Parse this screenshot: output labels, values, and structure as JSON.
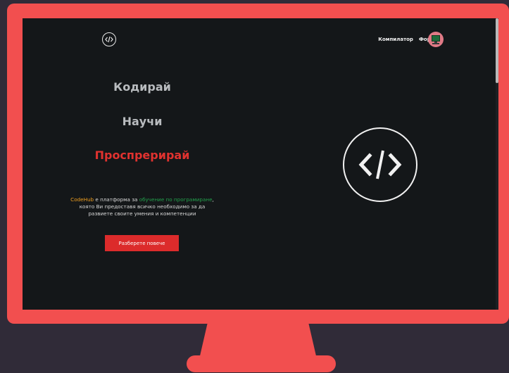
{
  "nav": {
    "logo_icon": "code-brackets-icon",
    "links": [
      {
        "label": "Компилатор"
      },
      {
        "label": "Форум"
      }
    ],
    "avatar_icon": "computer-avatar-icon"
  },
  "hero": {
    "words": [
      "Кодирай",
      "Научи",
      "Проспрерирай"
    ],
    "tagline": {
      "brand": "CodeHub",
      "part1": " е платформа за ",
      "highlight": "обучение по програмиране",
      "part2": ", която Ви предоставя всичко необходимо за да развиете своите умения и компетенции"
    },
    "cta_label": "Разберете повече",
    "hero_icon": "code-brackets-icon"
  },
  "colors": {
    "frame": "#f24f4f",
    "screen_bg": "#141719",
    "accent_red": "#e0322f",
    "brand_orange": "#f2a01f",
    "highlight_green": "#23a04c"
  }
}
